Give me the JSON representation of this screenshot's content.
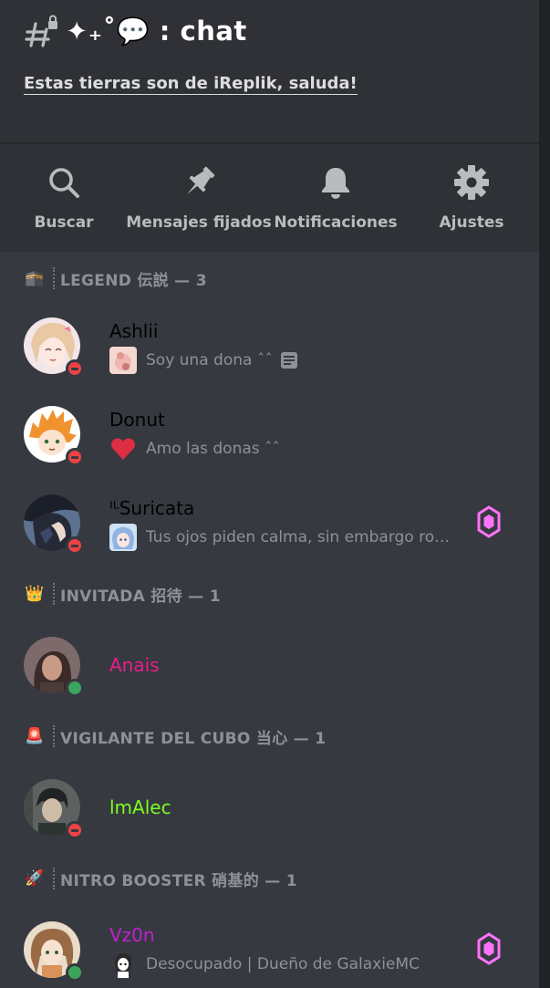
{
  "channel": {
    "name": "✦₊˚💬 : chat",
    "topic": "Estas tierras son de iReplik, saluda!"
  },
  "actions": [
    {
      "label": "Buscar",
      "icon": "search-icon"
    },
    {
      "label": "Mensajes fijados",
      "icon": "pin-icon"
    },
    {
      "label": "Notificaciones",
      "icon": "bell-icon"
    },
    {
      "label": "Ajustes",
      "icon": "gear-icon"
    }
  ],
  "groups": [
    {
      "emoji": "🕋",
      "name": "LEGEND 伝説 — 3"
    },
    {
      "emoji": "👑",
      "name": "INVITADA 招待 — 1"
    },
    {
      "emoji": "🚨",
      "name": "VIGILANTE DEL CUBO 当心 — 1"
    },
    {
      "emoji": "🚀",
      "name": "NITRO BOOSTER 硝基的 — 1"
    }
  ],
  "members": [
    {
      "name": "Ashlii",
      "status_text": "Soy una dona ˆˆ",
      "presence": "dnd",
      "name_color": "#000000",
      "boosting": false
    },
    {
      "name": "Donut",
      "status_text": "Amo las donas ˆˆ",
      "status_emoji": "❤",
      "presence": "dnd",
      "name_color": "#000000",
      "boosting": false
    },
    {
      "name": "ᴵᴸSuricata",
      "status_text": "Tus ojos piden calma, sin embargo rom...",
      "presence": "dnd",
      "name_color": "#000000",
      "boosting": true
    },
    {
      "name": "Anais",
      "status_text": "",
      "presence": "online",
      "name_color": "#e91e8c",
      "boosting": false
    },
    {
      "name": "lmAlec",
      "status_text": "",
      "presence": "dnd",
      "name_color": "#7cff1f",
      "boosting": false
    },
    {
      "name": "Vz0n",
      "status_text": "Desocupado | Dueño de GalaxieMC",
      "presence": "online",
      "name_color": "#c020d0",
      "boosting": true
    }
  ],
  "colors": {
    "boost": "#ff73fa",
    "dnd": "#ed4245",
    "online": "#3ba55d"
  }
}
